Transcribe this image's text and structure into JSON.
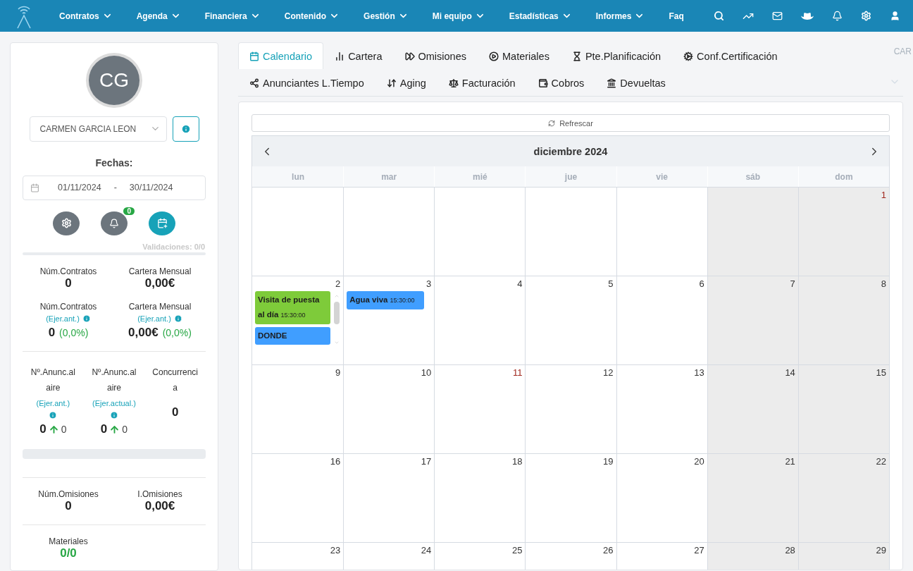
{
  "nav": {
    "items": [
      {
        "label": "Contratos",
        "caret": true
      },
      {
        "label": "Agenda",
        "caret": true
      },
      {
        "label": "Financiera",
        "caret": true
      },
      {
        "label": "Contenido",
        "caret": true
      },
      {
        "label": "Gestión",
        "caret": true
      },
      {
        "label": "Mi equipo",
        "caret": true
      },
      {
        "label": "Estadísticas",
        "caret": true
      },
      {
        "label": "Informes",
        "caret": true
      },
      {
        "label": "Faq",
        "caret": false
      }
    ]
  },
  "profile": {
    "initials": "CG",
    "user_select": "CARMEN GARCIA LEON",
    "dates_label": "Fechas:",
    "date_from": "01/11/2024",
    "date_sep": "-",
    "date_to": "30/11/2024",
    "notifications_badge": "0",
    "validations": {
      "text": "Validaciones: 0/0",
      "level": 0
    },
    "progress_bar": {
      "level": 0
    }
  },
  "stats": [
    {
      "label": "Núm.Contratos",
      "value": "0"
    },
    {
      "label": "Cartera Mensual",
      "value": "0,00€"
    }
  ],
  "prev_stats": [
    {
      "label": "Núm.Contratos",
      "sub": "(Ejer.ant.)",
      "value": "0",
      "pct": "(0,0%)"
    },
    {
      "label": "Cartera Mensual",
      "sub": "(Ejer.ant.)",
      "value": "0,00€",
      "pct": "(0,0%)"
    }
  ],
  "ads": [
    {
      "label": "Nº.Anunc.al aire",
      "sub": "(Ejer.ant.)",
      "value": "0",
      "delta": "0"
    },
    {
      "label": "Nº.Anunc.al aire",
      "sub": "(Ejer.actual.)",
      "value": "0",
      "delta": "0"
    },
    {
      "label": "Concurrencia",
      "value": "0"
    }
  ],
  "omissions": [
    {
      "label": "Núm.Omisiones",
      "value": "0"
    },
    {
      "label": "I.Omisiones",
      "value": "0,00€"
    }
  ],
  "materials": {
    "label": "Materiales",
    "value": "0/0"
  },
  "tabs": [
    {
      "label": "Calendario",
      "selected": true
    },
    {
      "label": "Cartera",
      "selected": false
    },
    {
      "label": "Omisiones",
      "selected": false
    },
    {
      "label": "Materiales",
      "selected": false
    },
    {
      "label": "Pte.Planificación",
      "selected": false
    },
    {
      "label": "Conf.Certificación",
      "selected": false
    },
    {
      "label": "Anunciantes L.Tiempo",
      "selected": false
    },
    {
      "label": "Aging",
      "selected": false
    },
    {
      "label": "Facturación",
      "selected": false
    },
    {
      "label": "Cobros",
      "selected": false
    },
    {
      "label": "Devueltas",
      "selected": false
    }
  ],
  "corner_text": "CAR",
  "refresh": "Refrescar",
  "calendar": {
    "title": "diciembre 2024",
    "weekdays": [
      "lun",
      "mar",
      "mié",
      "jue",
      "vie",
      "sáb",
      "dom"
    ],
    "weeks": [
      [
        {
          "kind": "empty"
        },
        {
          "kind": "empty"
        },
        {
          "kind": "empty"
        },
        {
          "kind": "empty"
        },
        {
          "kind": "empty"
        },
        {
          "kind": "empty"
        },
        {
          "kind": "day",
          "day": "1",
          "holiday": true
        }
      ],
      [
        {
          "kind": "day",
          "day": "2",
          "holiday": false,
          "events": [
            {
              "title": "Visita de puesta al día",
              "time": "15:30:00",
              "color": "#7ecb3a"
            },
            {
              "title": "DONDE",
              "color": "#409eff"
            }
          ]
        },
        {
          "kind": "day",
          "day": "3",
          "holiday": false,
          "events": [
            {
              "title": "Agua viva",
              "time": "15:30:00",
              "color": "#409eff"
            }
          ]
        },
        {
          "kind": "day",
          "day": "4",
          "holiday": false
        },
        {
          "kind": "day",
          "day": "5",
          "holiday": false
        },
        {
          "kind": "day",
          "day": "6",
          "holiday": false
        },
        {
          "kind": "day",
          "day": "7",
          "holiday": false
        },
        {
          "kind": "day",
          "day": "8",
          "holiday": false
        }
      ],
      [
        {
          "kind": "day",
          "day": "9",
          "holiday": false
        },
        {
          "kind": "day",
          "day": "10",
          "holiday": false
        },
        {
          "kind": "day",
          "day": "11",
          "holiday": true
        },
        {
          "kind": "day",
          "day": "12",
          "holiday": false
        },
        {
          "kind": "day",
          "day": "13",
          "holiday": false
        },
        {
          "kind": "day",
          "day": "14",
          "holiday": false
        },
        {
          "kind": "day",
          "day": "15",
          "holiday": false
        }
      ],
      [
        {
          "kind": "day",
          "day": "16",
          "holiday": false
        },
        {
          "kind": "day",
          "day": "17",
          "holiday": false
        },
        {
          "kind": "day",
          "day": "18",
          "holiday": false
        },
        {
          "kind": "day",
          "day": "19",
          "holiday": false
        },
        {
          "kind": "day",
          "day": "20",
          "holiday": false
        },
        {
          "kind": "day",
          "day": "21",
          "holiday": false
        },
        {
          "kind": "day",
          "day": "22",
          "holiday": false
        }
      ],
      [
        {
          "kind": "day",
          "day": "23",
          "holiday": false
        },
        {
          "kind": "day",
          "day": "24",
          "holiday": false
        },
        {
          "kind": "day",
          "day": "25",
          "holiday": false
        },
        {
          "kind": "day",
          "day": "26",
          "holiday": false
        },
        {
          "kind": "day",
          "day": "27",
          "holiday": false
        },
        {
          "kind": "day",
          "day": "28",
          "holiday": false
        },
        {
          "kind": "day",
          "day": "29",
          "holiday": false
        }
      ]
    ]
  }
}
